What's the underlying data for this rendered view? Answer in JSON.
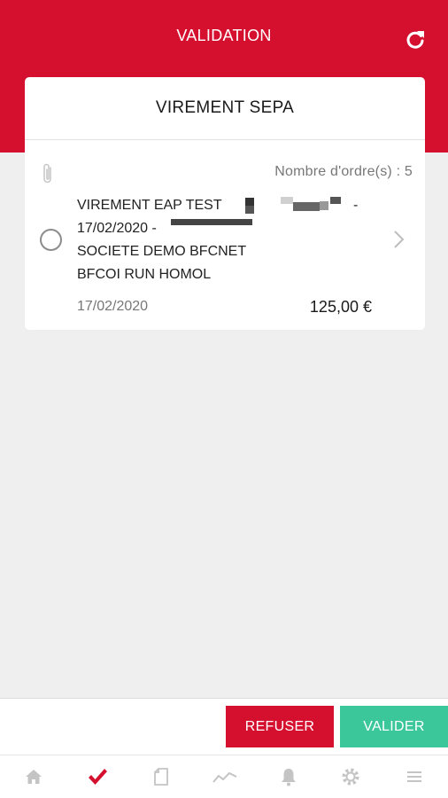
{
  "header": {
    "title": "VALIDATION",
    "refresh_icon": "refresh-icon"
  },
  "card": {
    "title": "VIREMENT SEPA",
    "order_count_label": "Nombre d'ordre(s) :",
    "order_count_value": "5",
    "attachment_icon": "paperclip-icon",
    "item": {
      "line1": "VIREMENT EAP TEST",
      "line1_suffix": "-",
      "line2": "17/02/2020 -",
      "line3": "SOCIETE DEMO BFCNET",
      "line4": "BFCOI RUN HOMOL",
      "date": "17/02/2020",
      "amount": "125,00 €",
      "selected": false
    }
  },
  "actions": {
    "refuse_label": "REFUSER",
    "validate_label": "VALIDER"
  },
  "colors": {
    "brand_red": "#d5102f",
    "validate_green": "#3cc79a"
  },
  "nav": [
    {
      "icon": "home-icon",
      "active": false
    },
    {
      "icon": "checkmark-icon",
      "active": true
    },
    {
      "icon": "document-icon",
      "active": false
    },
    {
      "icon": "chart-line-icon",
      "active": false
    },
    {
      "icon": "bell-icon",
      "active": false
    },
    {
      "icon": "gear-icon",
      "active": false
    },
    {
      "icon": "menu-icon",
      "active": false
    }
  ]
}
